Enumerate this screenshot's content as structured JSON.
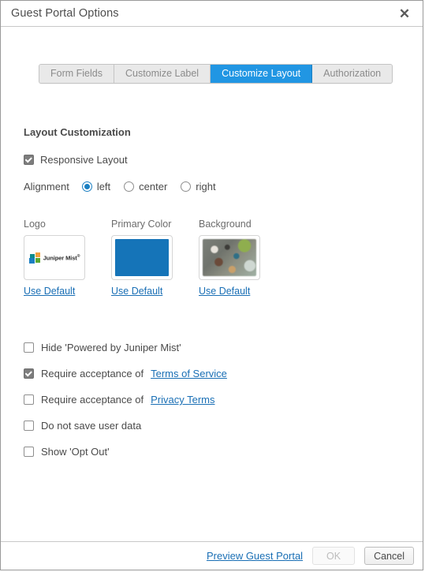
{
  "window": {
    "title": "Guest Portal Options",
    "close_icon": "close-icon"
  },
  "tabs": [
    {
      "label": "Form Fields",
      "active": false
    },
    {
      "label": "Customize Label",
      "active": false
    },
    {
      "label": "Customize Layout",
      "active": true
    },
    {
      "label": "Authorization",
      "active": false
    }
  ],
  "section": {
    "title": "Layout Customization",
    "responsive": {
      "label": "Responsive Layout",
      "checked": true
    },
    "alignment": {
      "label": "Alignment",
      "selected": "left",
      "options": [
        {
          "label": "left",
          "selected": true
        },
        {
          "label": "center",
          "selected": false
        },
        {
          "label": "right",
          "selected": false
        }
      ]
    }
  },
  "assets": [
    {
      "label": "Logo",
      "kind": "logo-image",
      "logo_text": "Juniper Mist",
      "logo_trademark": "®",
      "use_default": "Use Default"
    },
    {
      "label": "Primary Color",
      "kind": "color-swatch",
      "color": "#1574b8",
      "use_default": "Use Default"
    },
    {
      "label": "Background",
      "kind": "image-thumbnail",
      "use_default": "Use Default"
    }
  ],
  "options": [
    {
      "label": "Hide 'Powered by Juniper Mist'",
      "checked": false,
      "link": null
    },
    {
      "label": "Require acceptance of",
      "checked": true,
      "link": "Terms of Service"
    },
    {
      "label": "Require acceptance of",
      "checked": false,
      "link": "Privacy Terms"
    },
    {
      "label": "Do not save user data",
      "checked": false,
      "link": null
    },
    {
      "label": "Show 'Opt Out'",
      "checked": false,
      "link": null
    }
  ],
  "footer": {
    "preview_link": "Preview Guest Portal",
    "ok_label": "OK",
    "ok_disabled": true,
    "cancel_label": "Cancel"
  },
  "colors": {
    "accent_blue": "#2196e3",
    "link_blue": "#1a6fb5",
    "primary_color_swatch": "#1574b8",
    "radio_blue": "#1b7fc2"
  }
}
